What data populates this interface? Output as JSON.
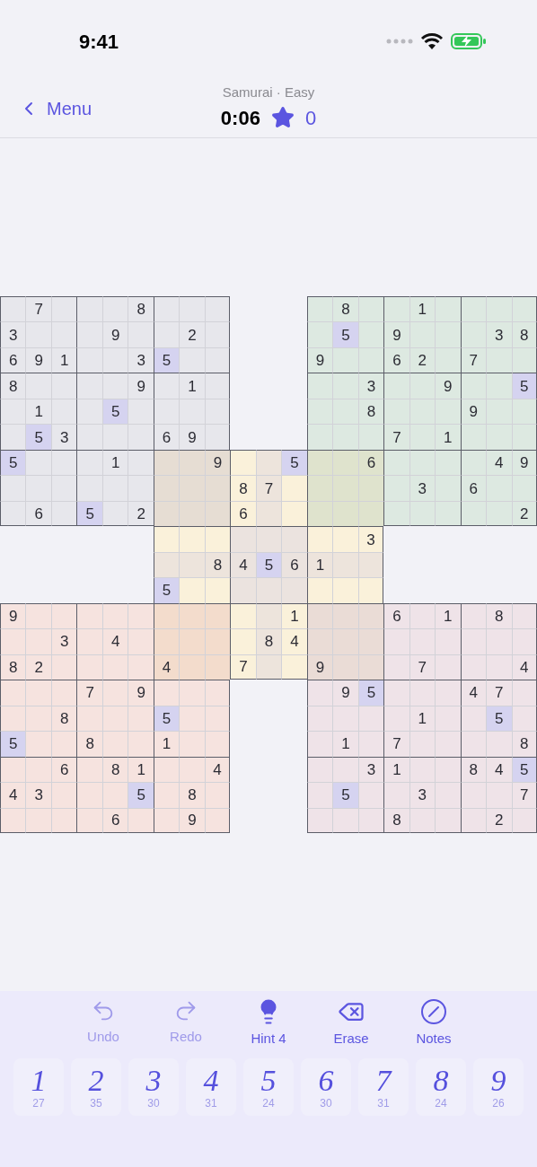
{
  "status_bar": {
    "time": "9:41"
  },
  "nav": {
    "back": "Menu",
    "subtitle": "Samurai · Easy",
    "timer": "0:06",
    "score": "0"
  },
  "board": {
    "grids": [
      {
        "kind": "top_left",
        "rows": [
          [
            null,
            "7",
            null,
            null,
            null,
            "8",
            null,
            null,
            null
          ],
          [
            "3",
            null,
            null,
            null,
            "9",
            null,
            null,
            "2",
            null
          ],
          [
            "6",
            "9",
            "1",
            null,
            null,
            "3",
            {
              "digit": "5",
              "highlighted": true
            },
            null,
            null
          ],
          [
            "8",
            null,
            null,
            null,
            null,
            "9",
            null,
            "1",
            null
          ],
          [
            null,
            "1",
            null,
            null,
            {
              "digit": "5",
              "highlighted": true
            },
            null,
            null,
            null,
            null
          ],
          [
            null,
            {
              "digit": "5",
              "highlighted": true
            },
            "3",
            null,
            null,
            null,
            "6",
            "9",
            null
          ],
          [
            {
              "digit": "5",
              "highlighted": true
            },
            null,
            null,
            null,
            "1",
            null,
            null,
            null,
            "9"
          ],
          [
            null,
            null,
            null,
            null,
            null,
            null,
            null,
            null,
            null
          ],
          [
            null,
            "6",
            null,
            {
              "digit": "5",
              "highlighted": true
            },
            null,
            "2",
            null,
            null,
            null
          ]
        ]
      },
      {
        "kind": "top_right",
        "rows": [
          [
            null,
            "8",
            null,
            null,
            "1",
            null,
            null,
            null,
            null
          ],
          [
            null,
            {
              "digit": "5",
              "highlighted": true
            },
            null,
            "9",
            null,
            null,
            null,
            "3",
            "8"
          ],
          [
            "9",
            null,
            null,
            "6",
            "2",
            null,
            "7",
            null,
            null
          ],
          [
            null,
            null,
            "3",
            null,
            null,
            "9",
            null,
            null,
            {
              "digit": "5",
              "highlighted": true
            }
          ],
          [
            null,
            null,
            "8",
            null,
            null,
            null,
            "9",
            null,
            null
          ],
          [
            null,
            null,
            null,
            "7",
            null,
            "1",
            null,
            null,
            null
          ],
          [
            null,
            null,
            "6",
            null,
            null,
            null,
            null,
            "4",
            "9"
          ],
          [
            null,
            null,
            null,
            null,
            "3",
            null,
            "6",
            null,
            null
          ],
          [
            null,
            null,
            null,
            null,
            null,
            null,
            null,
            null,
            "2"
          ]
        ]
      },
      {
        "kind": "center",
        "rows": [
          [
            null,
            null,
            null,
            null,
            null,
            {
              "digit": "5",
              "highlighted": true
            },
            null,
            null,
            null
          ],
          [
            null,
            null,
            null,
            "8",
            "7",
            null,
            null,
            null,
            null
          ],
          [
            null,
            null,
            null,
            "6",
            null,
            null,
            null,
            null,
            null
          ],
          [
            null,
            null,
            null,
            null,
            null,
            null,
            null,
            null,
            "3"
          ],
          [
            null,
            null,
            "8",
            "4",
            {
              "digit": "5",
              "highlighted": true
            },
            "6",
            "1",
            null,
            null
          ],
          [
            {
              "digit": "5",
              "highlighted": true
            },
            null,
            null,
            null,
            null,
            null,
            null,
            null,
            null
          ],
          [
            null,
            null,
            null,
            null,
            null,
            "1",
            null,
            null,
            null
          ],
          [
            null,
            null,
            null,
            null,
            "8",
            "4",
            null,
            null,
            null
          ],
          [
            null,
            null,
            null,
            "7",
            null,
            null,
            null,
            null,
            null
          ]
        ]
      },
      {
        "kind": "bottom_left",
        "rows": [
          [
            "9",
            null,
            null,
            null,
            null,
            null,
            null,
            null,
            null
          ],
          [
            null,
            null,
            "3",
            null,
            "4",
            null,
            null,
            null,
            null
          ],
          [
            "8",
            "2",
            null,
            null,
            null,
            null,
            "4",
            null,
            null
          ],
          [
            null,
            null,
            null,
            "7",
            null,
            "9",
            null,
            null,
            null
          ],
          [
            null,
            null,
            "8",
            null,
            null,
            null,
            {
              "digit": "5",
              "highlighted": true
            },
            null,
            null
          ],
          [
            {
              "digit": "5",
              "highlighted": true
            },
            null,
            null,
            "8",
            null,
            null,
            "1",
            null,
            null
          ],
          [
            null,
            null,
            "6",
            null,
            "8",
            "1",
            null,
            null,
            "4"
          ],
          [
            "4",
            "3",
            null,
            null,
            null,
            {
              "digit": "5",
              "highlighted": true
            },
            null,
            "8",
            null
          ],
          [
            null,
            null,
            null,
            null,
            "6",
            null,
            null,
            "9",
            null
          ]
        ]
      },
      {
        "kind": "bottom_right",
        "rows": [
          [
            null,
            null,
            null,
            "6",
            null,
            "1",
            null,
            "8",
            null
          ],
          [
            null,
            null,
            null,
            null,
            null,
            null,
            null,
            null,
            null
          ],
          [
            "9",
            null,
            null,
            null,
            "7",
            null,
            null,
            null,
            "4"
          ],
          [
            null,
            "9",
            {
              "digit": "5",
              "highlighted": true
            },
            null,
            null,
            null,
            "4",
            "7",
            null
          ],
          [
            null,
            null,
            null,
            null,
            "1",
            null,
            null,
            {
              "digit": "5",
              "highlighted": true
            },
            null
          ],
          [
            null,
            "1",
            null,
            "7",
            null,
            null,
            null,
            null,
            "8"
          ],
          [
            null,
            null,
            "3",
            "1",
            null,
            null,
            "8",
            "4",
            {
              "digit": "5",
              "highlighted": true
            }
          ],
          [
            null,
            {
              "digit": "5",
              "highlighted": true
            },
            null,
            null,
            "3",
            null,
            null,
            null,
            "7"
          ],
          [
            null,
            null,
            null,
            "8",
            null,
            null,
            null,
            "2",
            null
          ]
        ]
      }
    ]
  },
  "toolbar": [
    {
      "kind": "undo",
      "label": "Undo",
      "disabled": true
    },
    {
      "kind": "redo",
      "label": "Redo",
      "disabled": true
    },
    {
      "kind": "hint",
      "label": "Hint 4",
      "disabled": false
    },
    {
      "kind": "erase",
      "label": "Erase",
      "disabled": false
    },
    {
      "kind": "notes",
      "label": "Notes",
      "disabled": false
    }
  ],
  "number_pad": [
    {
      "digit": "1",
      "count": "27"
    },
    {
      "digit": "2",
      "count": "35"
    },
    {
      "digit": "3",
      "count": "30"
    },
    {
      "digit": "4",
      "count": "31"
    },
    {
      "digit": "5",
      "count": "24"
    },
    {
      "digit": "6",
      "count": "30"
    },
    {
      "digit": "7",
      "count": "31"
    },
    {
      "digit": "8",
      "count": "24"
    },
    {
      "digit": "9",
      "count": "26"
    }
  ]
}
